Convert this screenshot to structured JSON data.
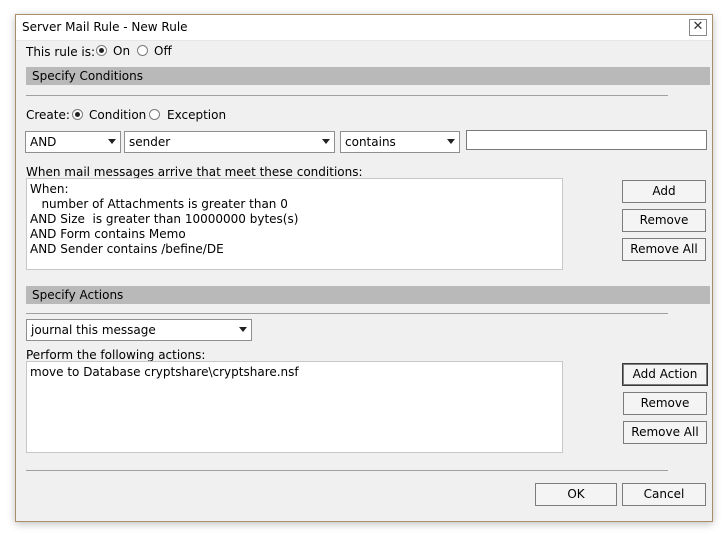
{
  "window": {
    "title": "Server Mail Rule - New Rule",
    "close_glyph": "✕"
  },
  "rule_state": {
    "label": "This rule is:",
    "on_label": "On",
    "off_label": "Off",
    "selected": "On"
  },
  "conditions": {
    "section_title": "Specify Conditions",
    "create_label": "Create:",
    "condition_label": "Condition",
    "exception_label": "Exception",
    "create_selected": "Condition",
    "logic_select": "AND",
    "field_select": "sender",
    "operator_select": "contains",
    "value_input": "",
    "list_label": "When mail messages arrive that meet these conditions:",
    "lines": [
      "When:",
      "   number of Attachments is greater than 0",
      "AND Size  is greater than 10000000 bytes(s)",
      "AND Form contains Memo",
      "AND Sender contains /befine/DE"
    ],
    "add_button": "Add",
    "remove_button": "Remove",
    "remove_all_button": "Remove All"
  },
  "actions": {
    "section_title": "Specify Actions",
    "action_select": "journal this message",
    "list_label": "Perform the following actions:",
    "lines": [
      "move to Database cryptshare\\cryptshare.nsf"
    ],
    "add_action_button": "Add Action",
    "remove_button": "Remove",
    "remove_all_button": "Remove All"
  },
  "footer": {
    "ok_button": "OK",
    "cancel_button": "Cancel"
  }
}
